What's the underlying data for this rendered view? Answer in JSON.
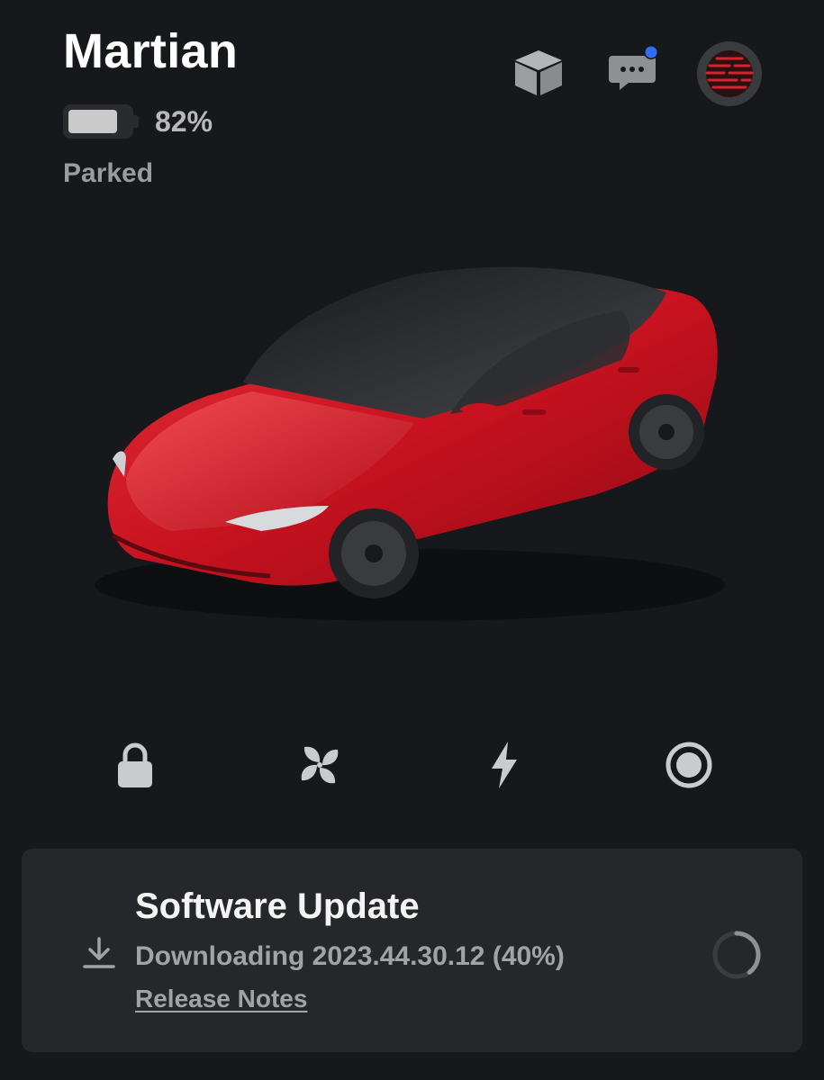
{
  "vehicle": {
    "name": "Martian",
    "battery_percent_label": "82%",
    "battery_level": 0.82,
    "status": "Parked"
  },
  "header_icons": {
    "toybox": "toybox-icon",
    "messages": "messages-icon",
    "messages_has_unread": true,
    "profile": "profile-avatar"
  },
  "quick_controls": [
    {
      "name": "lock-icon"
    },
    {
      "name": "climate-fan-icon"
    },
    {
      "name": "charge-bolt-icon"
    },
    {
      "name": "media-record-icon"
    }
  ],
  "software_update": {
    "title": "Software Update",
    "detail": "Downloading 2023.44.30.12 (40%)",
    "progress": 0.4,
    "release_notes_label": "Release Notes",
    "icon": "download-icon"
  },
  "colors": {
    "background": "#17181b",
    "card": "#26272b",
    "car_red": "#c8121f",
    "unread_dot": "#2f6df6"
  }
}
